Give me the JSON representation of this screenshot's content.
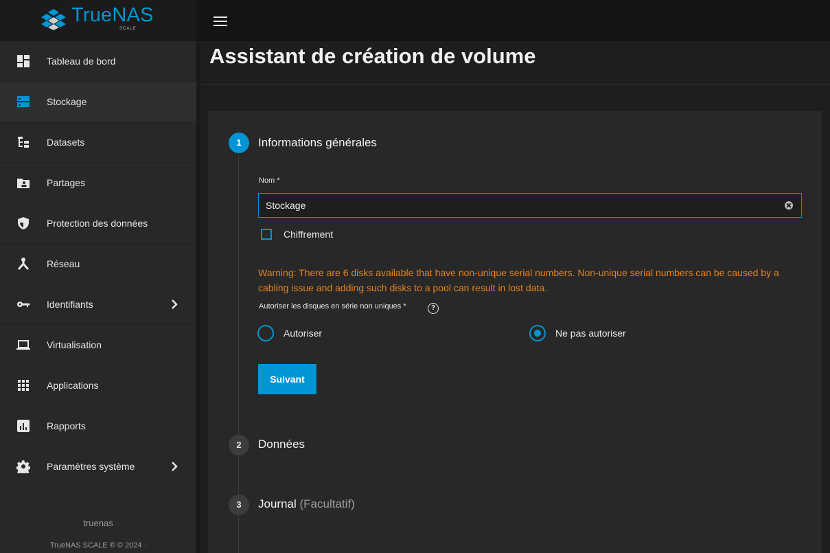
{
  "header": {
    "logo_text": "TrueNAS",
    "logo_sub": "SCALE",
    "brand_color": "#0095d5"
  },
  "sidebar": {
    "items": [
      {
        "label": "Tableau de bord",
        "icon": "dashboard-icon"
      },
      {
        "label": "Stockage",
        "icon": "storage-icon",
        "active": true
      },
      {
        "label": "Datasets",
        "icon": "datasets-icon"
      },
      {
        "label": "Partages",
        "icon": "shares-icon"
      },
      {
        "label": "Protection des données",
        "icon": "shield-icon"
      },
      {
        "label": "Réseau",
        "icon": "network-icon"
      },
      {
        "label": "Identifiants",
        "icon": "key-icon",
        "has_submenu": true
      },
      {
        "label": "Virtualisation",
        "icon": "laptop-icon"
      },
      {
        "label": "Applications",
        "icon": "apps-grid-icon"
      },
      {
        "label": "Rapports",
        "icon": "reports-icon"
      },
      {
        "label": "Paramètres système",
        "icon": "gear-icon",
        "has_submenu": true
      }
    ],
    "footer_host": "truenas",
    "footer_copyright": "TrueNAS SCALE ® © 2024 ·"
  },
  "main": {
    "title": "Assistant de création de volume",
    "steps": [
      {
        "number": "1",
        "title": "Informations générales",
        "optional": ""
      },
      {
        "number": "2",
        "title": "Données",
        "optional": ""
      },
      {
        "number": "3",
        "title": "Journal",
        "optional": "(Facultatif)"
      }
    ],
    "form": {
      "name_label": "Nom *",
      "name_value": "Stockage",
      "encryption_label": "Chiffrement",
      "encryption_checked": false,
      "warning": "Warning: There are 6 disks available that have non-unique serial numbers. Non-unique serial numbers can be caused by a cabling issue and adding such disks to a pool can result in lost data.",
      "serial_label": "Autoriser les disques en série non uniques *",
      "radio_allow": "Autoriser",
      "radio_deny": "Ne pas autoriser",
      "selected": "deny",
      "next_button": "Suivant"
    }
  }
}
